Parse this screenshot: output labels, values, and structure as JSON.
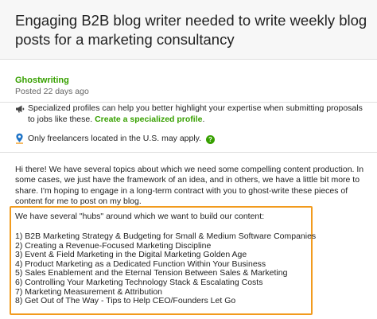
{
  "job": {
    "title": "Engaging B2B blog writer needed to write weekly blog posts for a marketing consultancy",
    "category": "Ghostwriting",
    "posted": "Posted 22 days ago"
  },
  "notices": {
    "specialized_text": "Specialized profiles can help you better highlight your expertise when submitting proposals to jobs like these.",
    "specialized_link": "Create a specialized profile",
    "specialized_end": ".",
    "location_text": "Only freelancers located in the U.S. may apply.",
    "help_badge": "?"
  },
  "description": {
    "intro": "Hi there! We have several topics about which we need some compelling content production. In some cases, we just have the framework of an idea, and in others, we have a little bit more to share. I'm hoping to engage in a long-term contract with you to ghost-write these pieces of content for me to post on my blog.",
    "hubs_intro": "We have several \"hubs\" around which we want to build our content:",
    "hubs": [
      "1) B2B Marketing Strategy & Budgeting for Small & Medium Software Companies",
      "2) Creating a Revenue-Focused Marketing Discipline",
      "3) Event & Field Marketing in the Digital Marketing Golden Age",
      "4) Product Marketing as a Dedicated Function Within Your Business",
      "5) Sales Enablement and the Eternal Tension Between Sales & Marketing",
      "6) Controlling Your Marketing Technology Stack & Escalating Costs",
      "7) Marketing Measurement & Attribution",
      "8) Get Out of The Way - Tips to Help CEO/Founders Let Go"
    ]
  },
  "colors": {
    "accent_green": "#37a000",
    "highlight_orange": "#f29b1d"
  },
  "icons": {
    "specialized": "megaphone-icon",
    "location": "location-pin-icon",
    "help": "help-circle-icon"
  }
}
